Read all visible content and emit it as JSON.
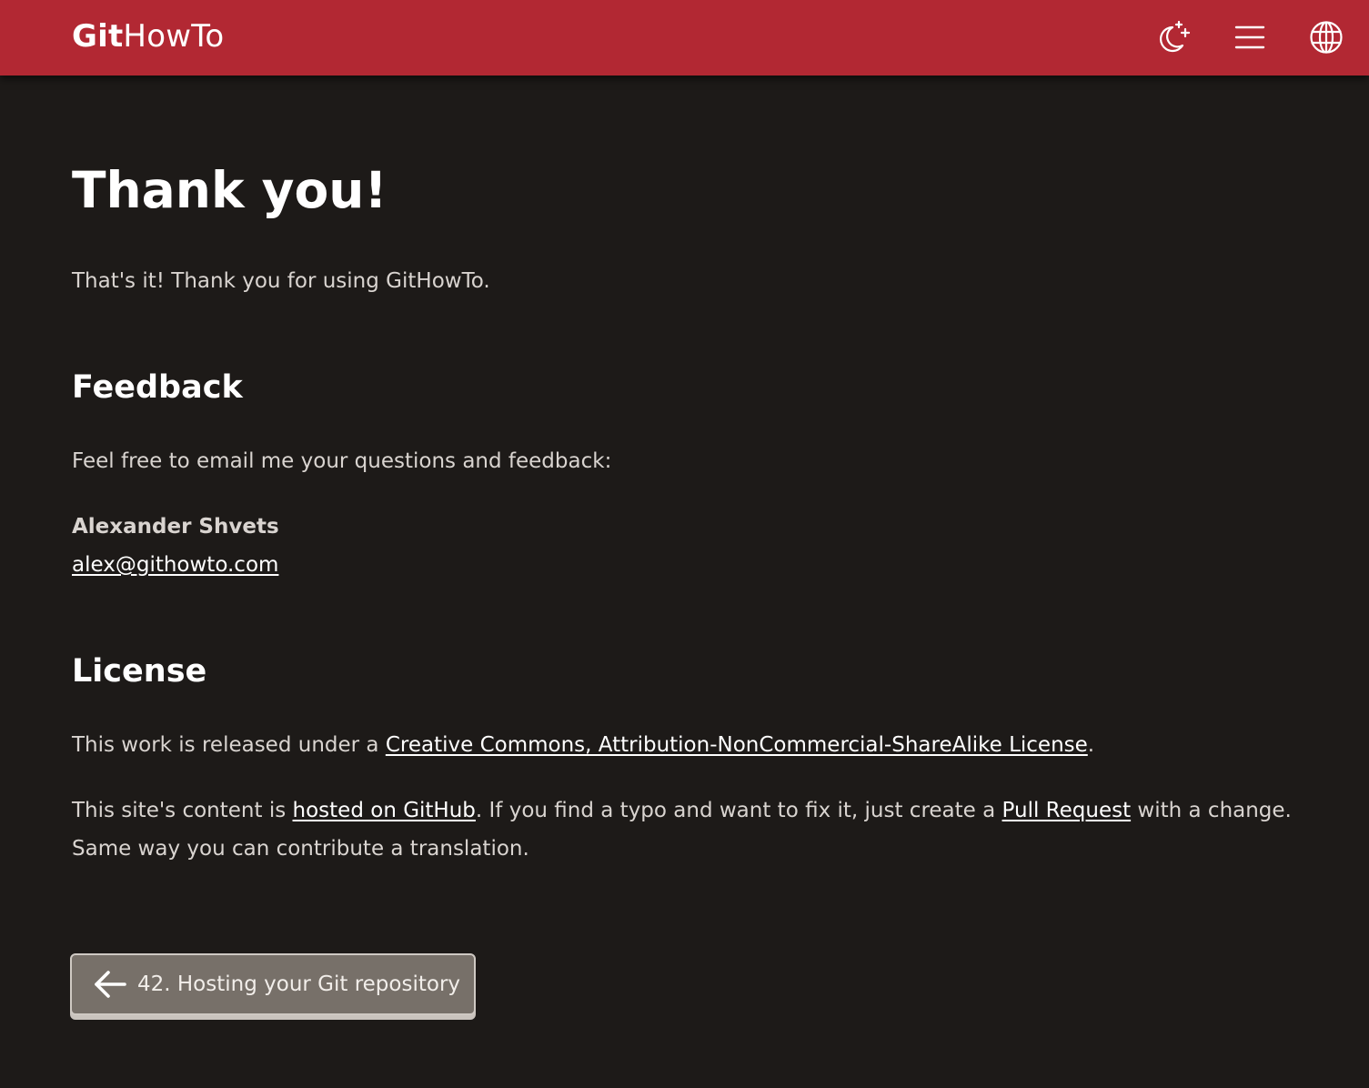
{
  "header": {
    "logo_bold": "Git",
    "logo_regular": "HowTo",
    "icons": [
      "theme-toggle-icon",
      "menu-icon",
      "globe-icon"
    ]
  },
  "main": {
    "title": "Thank you!",
    "intro": "That's it! Thank you for using GitHowTo.",
    "feedback": {
      "heading": "Feedback",
      "text": "Feel free to email me your questions and feedback:",
      "author": "Alexander Shvets",
      "email": "alex@githowto.com"
    },
    "license": {
      "heading": "License",
      "line1_prefix": "This work is released under a ",
      "line1_link": "Creative Commons, Attribution-NonCommercial-ShareAlike License",
      "line1_suffix": ".",
      "line2_prefix": "This site's content is ",
      "line2_link1": "hosted on GitHub",
      "line2_middle": ". If you find a typo and want to fix it, just create a ",
      "line2_link2": "Pull Request",
      "line2_suffix": " with a change. Same way you can contribute a translation."
    }
  },
  "navigation": {
    "prev_label": "42. Hosting your Git repository"
  },
  "colors": {
    "header_bg": "#b22833",
    "page_bg": "#1d1a18",
    "button_bg": "#777069"
  }
}
